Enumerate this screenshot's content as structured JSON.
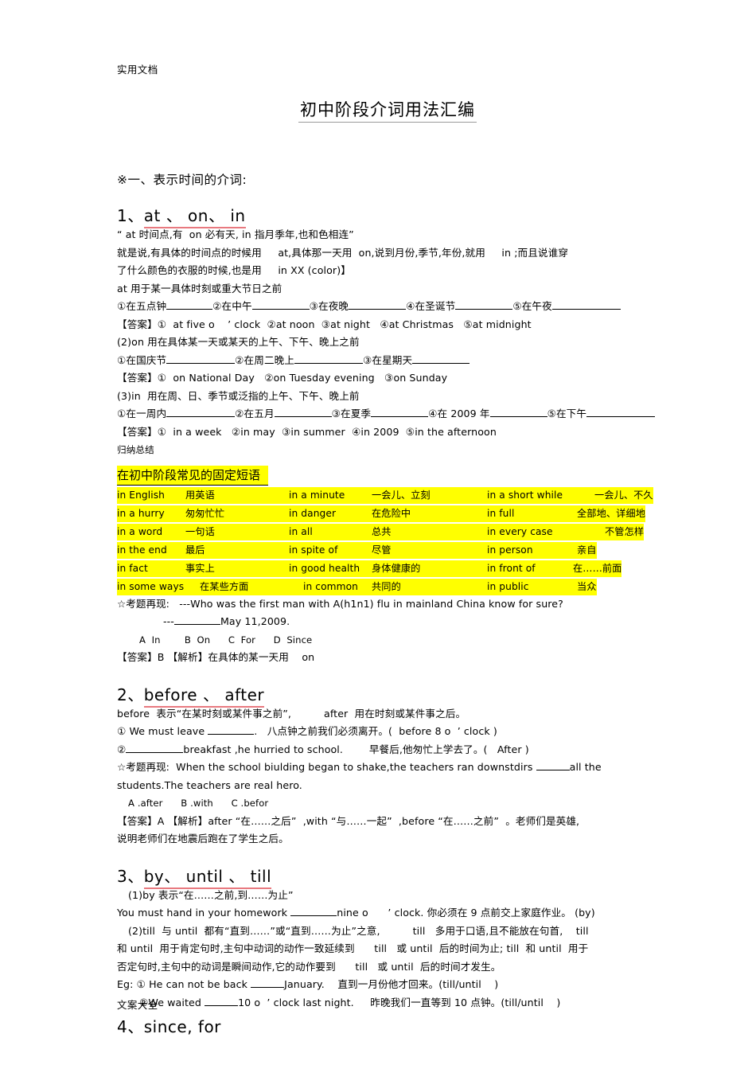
{
  "header": {
    "watermark": "实用文档"
  },
  "footer": {
    "watermark": "文案大全"
  },
  "title": "初中阶段介词用法汇编",
  "section_time_heading": "※一、表示时间的介词:",
  "s1": {
    "heading_num": "1、",
    "heading_text": "at 、 on、 in",
    "quote": "“ at 时间点,有  on 必有天, in 指月季年,也和色相连”",
    "explain1": "就是说,有具体的时间点的时候用     at,具体那一天用  on,说到月份,季节,年份,就用     in ;而且说谁穿",
    "explain2": "了什么颜色的衣服的时候,也是用     in XX (color)】",
    "at_rule": "at 用于某一具体时刻或重大节日之前",
    "at_items": [
      "①在五点钟",
      "②在中午",
      "③在夜晚",
      "④在圣诞节",
      "⑤在午夜"
    ],
    "at_answer": "【答案】①  at five o    ’ clock  ②at noon  ③at night   ④at Christmas   ⑤at midnight",
    "on_rule": "(2)on 用在具体某一天或某天的上午、下午、晚上之前",
    "on_items": [
      "①在国庆节",
      "②在周二晚上",
      "③在星期天"
    ],
    "on_answer": "【答案】①  on National Day   ②on Tuesday evening   ③on Sunday",
    "in_rule": "(3)in  用在周、日、季节或泛指的上午、下午、晚上前",
    "in_items": [
      "①在一周内",
      "②在五月",
      "③在夏季",
      "④在 2009 年",
      "⑤在下午"
    ],
    "in_answer": "【答案】①  in a week   ②in may  ③in summer  ④in 2009  ⑤in the afternoon",
    "summary_label": "归纳总结",
    "highlight_title": "在初中阶段常见的固定短语",
    "phrases": [
      [
        {
          "en": "in English",
          "cn": "用英语"
        },
        {
          "en": "in a minute",
          "cn": "一会儿、立刻"
        },
        {
          "en": "in a short while",
          "cn": "一会儿、不久"
        }
      ],
      [
        {
          "en": "in a hurry",
          "cn": "匆匆忙忙"
        },
        {
          "en": "in danger",
          "cn": "在危险中"
        },
        {
          "en": "in full",
          "cn": "全部地、详细地"
        }
      ],
      [
        {
          "en": "in a word",
          "cn": "一句话"
        },
        {
          "en": "in all",
          "cn": "总共"
        },
        {
          "en": "in every case",
          "cn": "不管怎样"
        }
      ],
      [
        {
          "en": "in the end",
          "cn": "最后"
        },
        {
          "en": "in spite of",
          "cn": "尽管"
        },
        {
          "en": "in person",
          "cn": "亲自"
        }
      ],
      [
        {
          "en": "in fact",
          "cn": "事实上"
        },
        {
          "en": "in good health",
          "cn": "身体健康的"
        },
        {
          "en": "in front of",
          "cn": "在……前面"
        }
      ],
      [
        {
          "en": "in some ways",
          "cn": "在某些方面"
        },
        {
          "en": "in common",
          "cn": "共同的"
        },
        {
          "en": "in public",
          "cn": "当众"
        }
      ]
    ],
    "exam_label": "☆考题再现:",
    "exam_q": "---Who was the first man with A(h1n1) flu in mainland China know for sure?",
    "exam_q2_pre": "---",
    "exam_q2_post": "May 11,2009.",
    "exam_options": "A  In        B  On      C  For      D  Since",
    "exam_answer": "【答案】B 【解析】在具体的某一天用    on"
  },
  "s2": {
    "heading_num": "2、",
    "heading_text": "before 、 after",
    "rule": "before  表示“在某时刻或某件事之前”,          after  用在时刻或某件事之后。",
    "ex1_pre": "① We must leave ",
    "ex1_post": ".   八点钟之前我们必须离开。(  before 8 o  ’ clock )",
    "ex2_pre": "②",
    "ex2_post": "breakfast ,he hurried to school.        早餐后,他匆忙上学去了。(   After )",
    "exam_label": "☆考题再现:",
    "exam_q_pre": "When the school biulding began to shake,the teachers ran downstdirs ",
    "exam_q_post": "all the",
    "exam_q2": "students.The teachers are real hero.",
    "exam_options": "A .after      B .with      C .befor",
    "exam_answer1": "【答案】A 【解析】after “在……之后”  ,with “与……一起”  ,before “在……之前”  。老师们是英雄,",
    "exam_answer2": "说明老师们在地震后跑在了学生之后。"
  },
  "s3": {
    "heading_num": "3、",
    "heading_text": "by、 until  、 till",
    "rule1": "(1)by 表示“在……之前,到……为止”",
    "ex1_pre": "You must hand in your homework ",
    "ex1_post": "nine o      ’ clock. 你必须在 9 点前交上家庭作业。 (by)",
    "rule2a": "(2)till  与 until  都有“直到……”或“直到……为止”之意,          till   多用于口语,且不能放在句首,    till",
    "rule2b": "和 until  用于肯定句时,主句中动词的动作一致延续到      till   或 until  后的时间为止; till  和 until  用于",
    "rule2c": "否定句时,主句中的动词是瞬间动作,它的动作要到      till   或 until  后的时间才发生。",
    "eg1_pre": "Eg: ① He can not be back ",
    "eg1_post": "January.    直到一月份他才回来。(till/until    )",
    "eg2_pre": "②We waited ",
    "eg2_post": "10 o  ’ clock last night.     昨晚我们一直等到 10 点钟。(till/until    )"
  },
  "s4": {
    "heading_num": "4、",
    "heading_text": "since, for"
  }
}
